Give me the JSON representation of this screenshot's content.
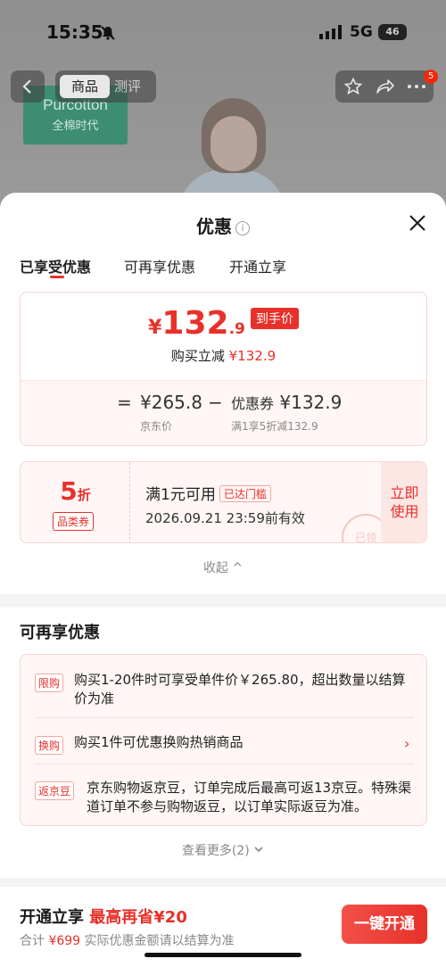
{
  "status_bar": {
    "time": "15:35",
    "network": "5G",
    "battery": "46"
  },
  "top_nav": {
    "tab_product": "商品",
    "tab_review": "测评",
    "cart_badge": "5"
  },
  "background": {
    "logo_line1": "Purcotton",
    "logo_line2": "全棉时代"
  },
  "sheet": {
    "title": "优惠",
    "tabs": [
      "已享受优惠",
      "可再享优惠",
      "开通立享"
    ],
    "price": {
      "currency": "¥",
      "integer": "132",
      "decimal": ".9",
      "tag": "到手价",
      "reduce_label": "购买立减",
      "reduce_value": "¥132.9"
    },
    "calc": {
      "equals": "=",
      "jd_price": "¥265.8",
      "jd_price_label": "京东价",
      "minus": "−",
      "coupon_label": "优惠券",
      "coupon_value": "¥132.9",
      "coupon_desc": "满1享5折减132.9"
    },
    "coupon": {
      "discount_number": "5",
      "discount_unit": "折",
      "type": "品类券",
      "condition": "满1元可用",
      "threshold_badge": "已达门槛",
      "valid_until": "2026.09.21 23:59前有效",
      "stamp": "已领",
      "use_line1": "立即",
      "use_line2": "使用"
    },
    "collapse_label": "收起 ^",
    "more": {
      "title": "可再享优惠",
      "items": [
        {
          "tag": "限购",
          "text": "购买1-20件时可享受单件价￥265.80，超出数量以结算价为准"
        },
        {
          "tag": "换购",
          "text": "购买1件可优惠换购热销商品"
        },
        {
          "tag": "返京豆",
          "text": "京东购物返京豆，订单完成后最高可返13京豆。特殊渠道订单不参与购物返豆，以订单实际返豆为准。"
        }
      ],
      "see_more": "查看更多(2)"
    },
    "footer": {
      "title": "开通立享",
      "highlight": "最高再省¥20",
      "total_label": "合计",
      "total_value": "¥699",
      "note": "实际优惠金额请以结算为准",
      "button": "一键开通"
    }
  }
}
